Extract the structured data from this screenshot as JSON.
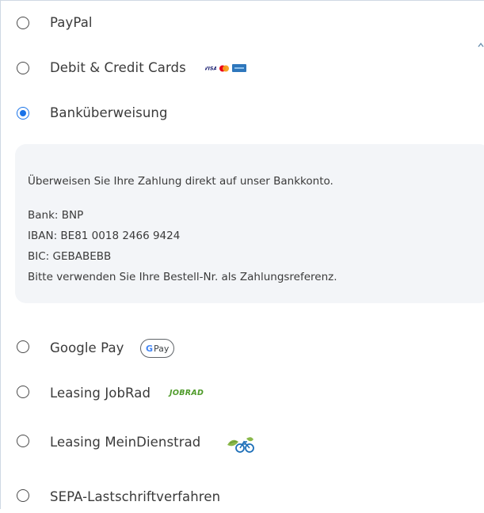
{
  "payment_methods": {
    "paypal": {
      "label": "PayPal"
    },
    "cards": {
      "label": "Debit & Credit Cards",
      "icons": [
        "visa-icon",
        "mastercard-icon",
        "amex-icon"
      ]
    },
    "bank": {
      "label": "Banküberweisung",
      "selected": true,
      "description": "Überweisen Sie Ihre Zahlung direkt auf unser Bankkonto.",
      "bank_line": "Bank: BNP",
      "iban_line": "IBAN: BE81 0018 2466 9424",
      "bic_line": "BIC: GEBABEBB",
      "reference_line": "Bitte verwenden Sie Ihre Bestell-Nr. als Zahlungsreferenz."
    },
    "googlepay": {
      "label": "Google Pay",
      "badge_g": "G",
      "badge_pay": "Pay"
    },
    "jobrad": {
      "label": "Leasing JobRad",
      "logo_text": "JOBRAD"
    },
    "meindienstrad": {
      "label": "Leasing MeinDienstrad"
    },
    "sepa": {
      "label": "SEPA-Lastschriftverfahren"
    }
  },
  "colors": {
    "accent": "#1a73e8",
    "panel_bg": "#f3f5f8",
    "jobrad_green": "#4f9b2a"
  }
}
